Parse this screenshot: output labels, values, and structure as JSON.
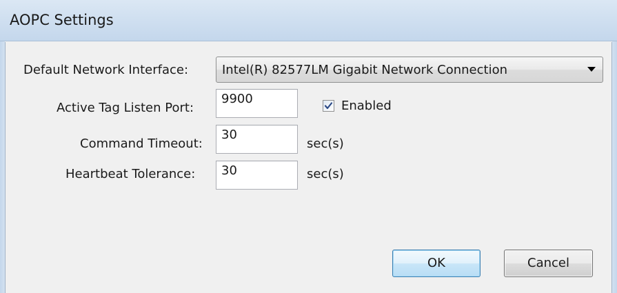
{
  "window": {
    "title": "AOPC Settings"
  },
  "form": {
    "network_interface": {
      "label": "Default Network Interface:",
      "selected": "Intel(R) 82577LM Gigabit Network Connection"
    },
    "listen_port": {
      "label": "Active Tag Listen Port:",
      "value": "9900",
      "enabled_label": "Enabled",
      "enabled": true
    },
    "command_timeout": {
      "label": "Command Timeout:",
      "value": "30",
      "unit": "sec(s)"
    },
    "heartbeat_tolerance": {
      "label": "Heartbeat Tolerance:",
      "value": "30",
      "unit": "sec(s)"
    }
  },
  "buttons": {
    "ok_label": "OK",
    "cancel_label": "Cancel"
  },
  "colors": {
    "titlebar": "#cfdff0",
    "ok_border": "#3c7fb1",
    "check_mark": "#2c4a86"
  }
}
